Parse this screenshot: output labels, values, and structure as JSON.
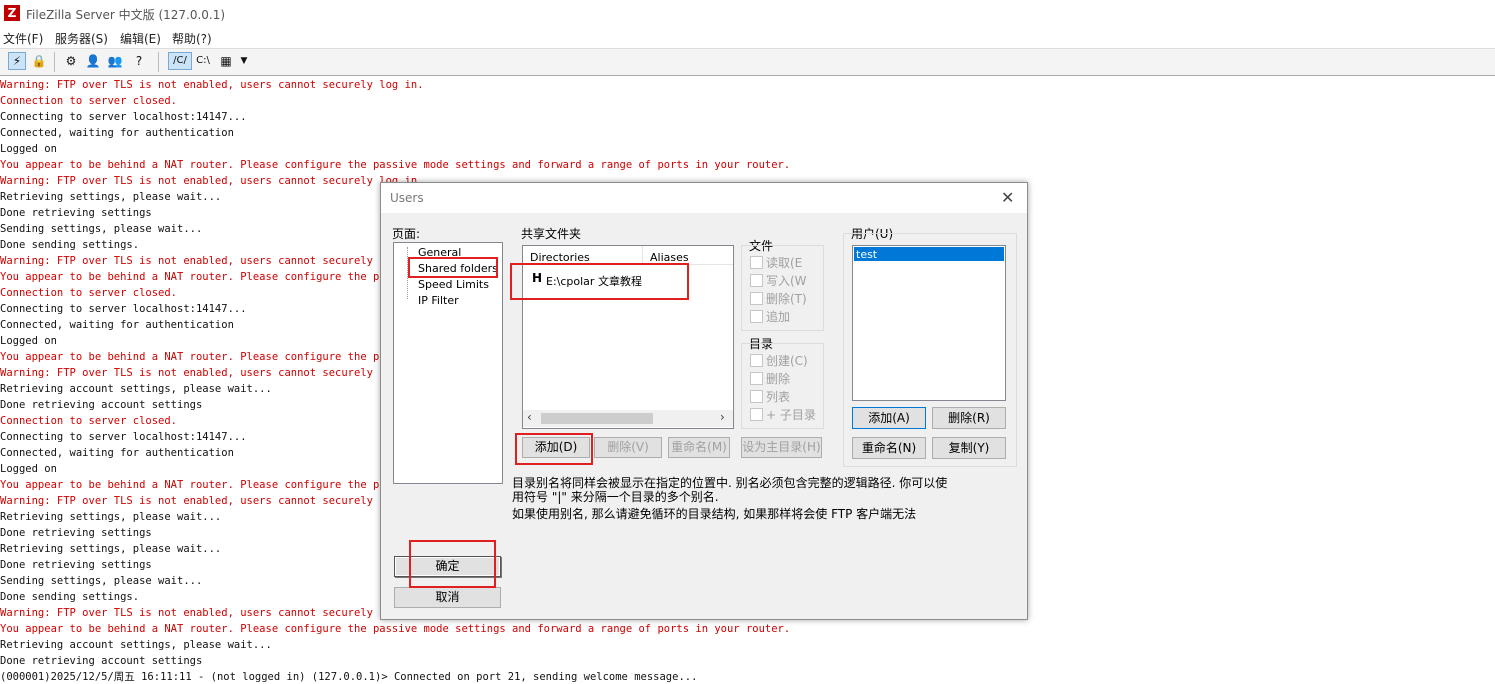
{
  "window": {
    "title": "FileZilla Server 中文版 (127.0.0.1)",
    "icon_letter": "Z"
  },
  "menu": [
    "文件(F)",
    "服务器(S)",
    "编辑(E)",
    "帮助(?)"
  ],
  "toolbar": {
    "path_unix": "/C/",
    "path_win": "C:\\"
  },
  "log": [
    {
      "text": "Warning: FTP over TLS is not enabled, users cannot securely log in.",
      "type": "err"
    },
    {
      "text": "Connection to server closed.",
      "type": "err"
    },
    {
      "text": "Connecting to server localhost:14147...",
      "type": "ok"
    },
    {
      "text": "Connected, waiting for authentication",
      "type": "ok"
    },
    {
      "text": "Logged on",
      "type": "ok"
    },
    {
      "text": "You appear to be behind a NAT router. Please configure the passive mode settings and forward a range of ports in your router.",
      "type": "err"
    },
    {
      "text": "Warning: FTP over TLS is not enabled, users cannot securely log in.",
      "type": "err"
    },
    {
      "text": "Retrieving settings, please wait...",
      "type": "ok"
    },
    {
      "text": "Done retrieving settings",
      "type": "ok"
    },
    {
      "text": "Sending settings, please wait...",
      "type": "ok"
    },
    {
      "text": "Done sending settings.",
      "type": "ok"
    },
    {
      "text": "Warning: FTP over TLS is not enabled, users cannot securely log in.",
      "type": "err"
    },
    {
      "text": "You appear to be behind a NAT router. Please configure the passive mode settings and forward a range of ports in your router.",
      "type": "err"
    },
    {
      "text": "Connection to server closed.",
      "type": "err"
    },
    {
      "text": "Connecting to server localhost:14147...",
      "type": "ok"
    },
    {
      "text": "Connected, waiting for authentication",
      "type": "ok"
    },
    {
      "text": "Logged on",
      "type": "ok"
    },
    {
      "text": "You appear to be behind a NAT router. Please configure the passive mode settings and forward a range of ports in your router.",
      "type": "err"
    },
    {
      "text": "Warning: FTP over TLS is not enabled, users cannot securely log in.",
      "type": "err"
    },
    {
      "text": "Retrieving account settings, please wait...",
      "type": "ok"
    },
    {
      "text": "Done retrieving account settings",
      "type": "ok"
    },
    {
      "text": "Connection to server closed.",
      "type": "err"
    },
    {
      "text": "Connecting to server localhost:14147...",
      "type": "ok"
    },
    {
      "text": "Connected, waiting for authentication",
      "type": "ok"
    },
    {
      "text": "Logged on",
      "type": "ok"
    },
    {
      "text": "You appear to be behind a NAT router. Please configure the passive mode settings and forward a range of ports in your router.",
      "type": "err"
    },
    {
      "text": "Warning: FTP over TLS is not enabled, users cannot securely log in.",
      "type": "err"
    },
    {
      "text": "Retrieving settings, please wait...",
      "type": "ok"
    },
    {
      "text": "Done retrieving settings",
      "type": "ok"
    },
    {
      "text": "Retrieving settings, please wait...",
      "type": "ok"
    },
    {
      "text": "Done retrieving settings",
      "type": "ok"
    },
    {
      "text": "Sending settings, please wait...",
      "type": "ok"
    },
    {
      "text": "Done sending settings.",
      "type": "ok"
    },
    {
      "text": "Warning: FTP over TLS is not enabled, users cannot securely log in.",
      "type": "err"
    },
    {
      "text": "You appear to be behind a NAT router. Please configure the passive mode settings and forward a range of ports in your router.",
      "type": "err"
    },
    {
      "text": "Retrieving account settings, please wait...",
      "type": "ok"
    },
    {
      "text": "Done retrieving account settings",
      "type": "ok"
    },
    {
      "text": "(000001)2025/12/5/周五 16:11:11 - (not logged in) (127.0.0.1)> Connected on port 21, sending welcome message...",
      "type": "ok"
    }
  ],
  "dialog": {
    "title": "Users",
    "close_glyph": "✕",
    "page_label": "页面:",
    "pages": [
      "General",
      "Shared folders",
      "Speed Limits",
      "IP Filter"
    ],
    "shared_label": "共享文件夹",
    "columns": {
      "dir": "Directories",
      "alias": "Aliases"
    },
    "folders": [
      {
        "home": "H",
        "path": "E:\\cpolar 文章教程"
      }
    ],
    "files_group": "文件",
    "file_perms": [
      "读取(E",
      "写入(W",
      "删除(T)",
      "追加"
    ],
    "dirs_group": "目录",
    "dir_perms": [
      "创建(C)",
      "删除",
      "列表",
      "+ 子目录"
    ],
    "folder_buttons": {
      "add": "添加(D)",
      "remove": "删除(V)",
      "rename": "重命名(M)",
      "home": "设为主目录(H)"
    },
    "users_label": "用户(U)",
    "users": [
      "test"
    ],
    "user_buttons": {
      "add": "添加(A)",
      "remove": "删除(R)",
      "rename": "重命名(N)",
      "copy": "复制(Y)"
    },
    "note1": "目录别名将同样会被显示在指定的位置中. 别名必须包含完整的逻辑路径. 你可以使",
    "note2": "用符号 \"|\" 来分隔一个目录的多个别名.",
    "note3": "如果使用别名, 那么请避免循环的目录结构, 如果那样将会使 FTP 客户端无法",
    "ok": "确定",
    "cancel": "取消"
  }
}
